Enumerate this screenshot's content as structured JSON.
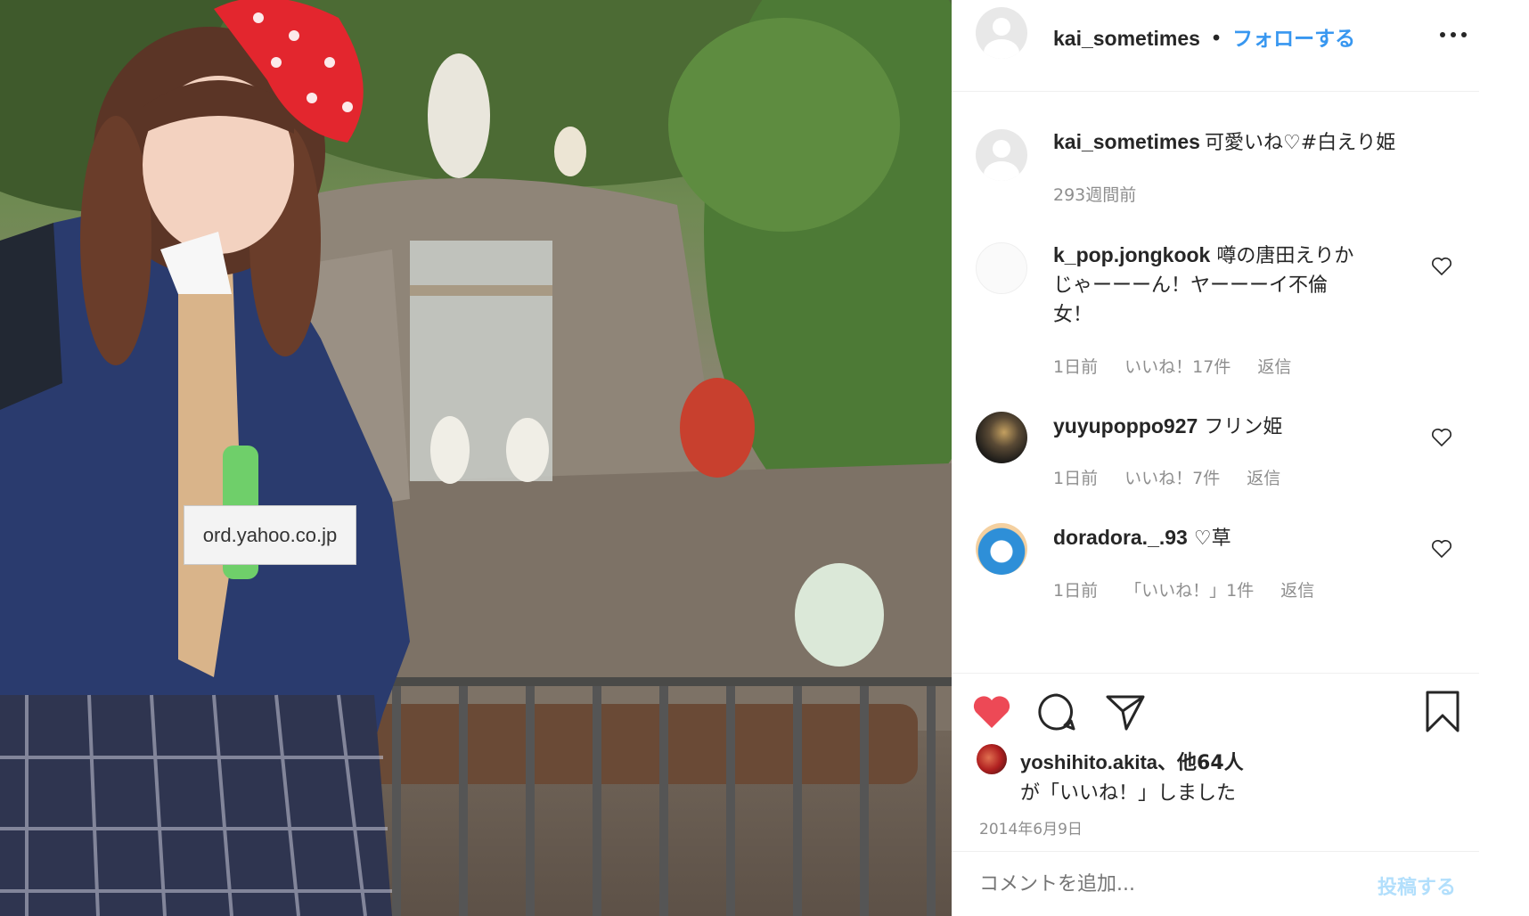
{
  "watermark": {
    "url": "ord.yahoo.co.jp"
  },
  "header": {
    "username": "kai_sometimes",
    "separator": "•",
    "follow": "フォローする"
  },
  "caption": {
    "username": "kai_sometimes",
    "text": "可愛いね♡",
    "hashtag": "#白えり姫",
    "time": "293週間前"
  },
  "comments": [
    {
      "username": "k_pop.jongkook",
      "line1": "噂の唐田えりか",
      "line2": "じゃーーーん！ヤーーーイ不倫",
      "line3": "女！",
      "time": "1日前",
      "likes": "いいね！17件",
      "reply": "返信"
    },
    {
      "username": "yuyupoppo927",
      "text": "フリン姫",
      "time": "1日前",
      "likes": "いいね！7件",
      "reply": "返信"
    },
    {
      "username": "doradora._.93",
      "text": "♡草",
      "time": "1日前",
      "likes": "「いいね！」1件",
      "reply": "返信"
    }
  ],
  "likes_info": {
    "liker": "yoshihito.akita",
    "others": "、他64人",
    "suffix": "が「いいね！」しました"
  },
  "date": "2014年6月9日",
  "add_comment": {
    "placeholder": "コメントを追加...",
    "post": "投稿する"
  },
  "colors": {
    "accent_blue": "#3897f0",
    "heart_red": "#ed4956",
    "text": "#262626",
    "muted": "#8e8e8e"
  }
}
